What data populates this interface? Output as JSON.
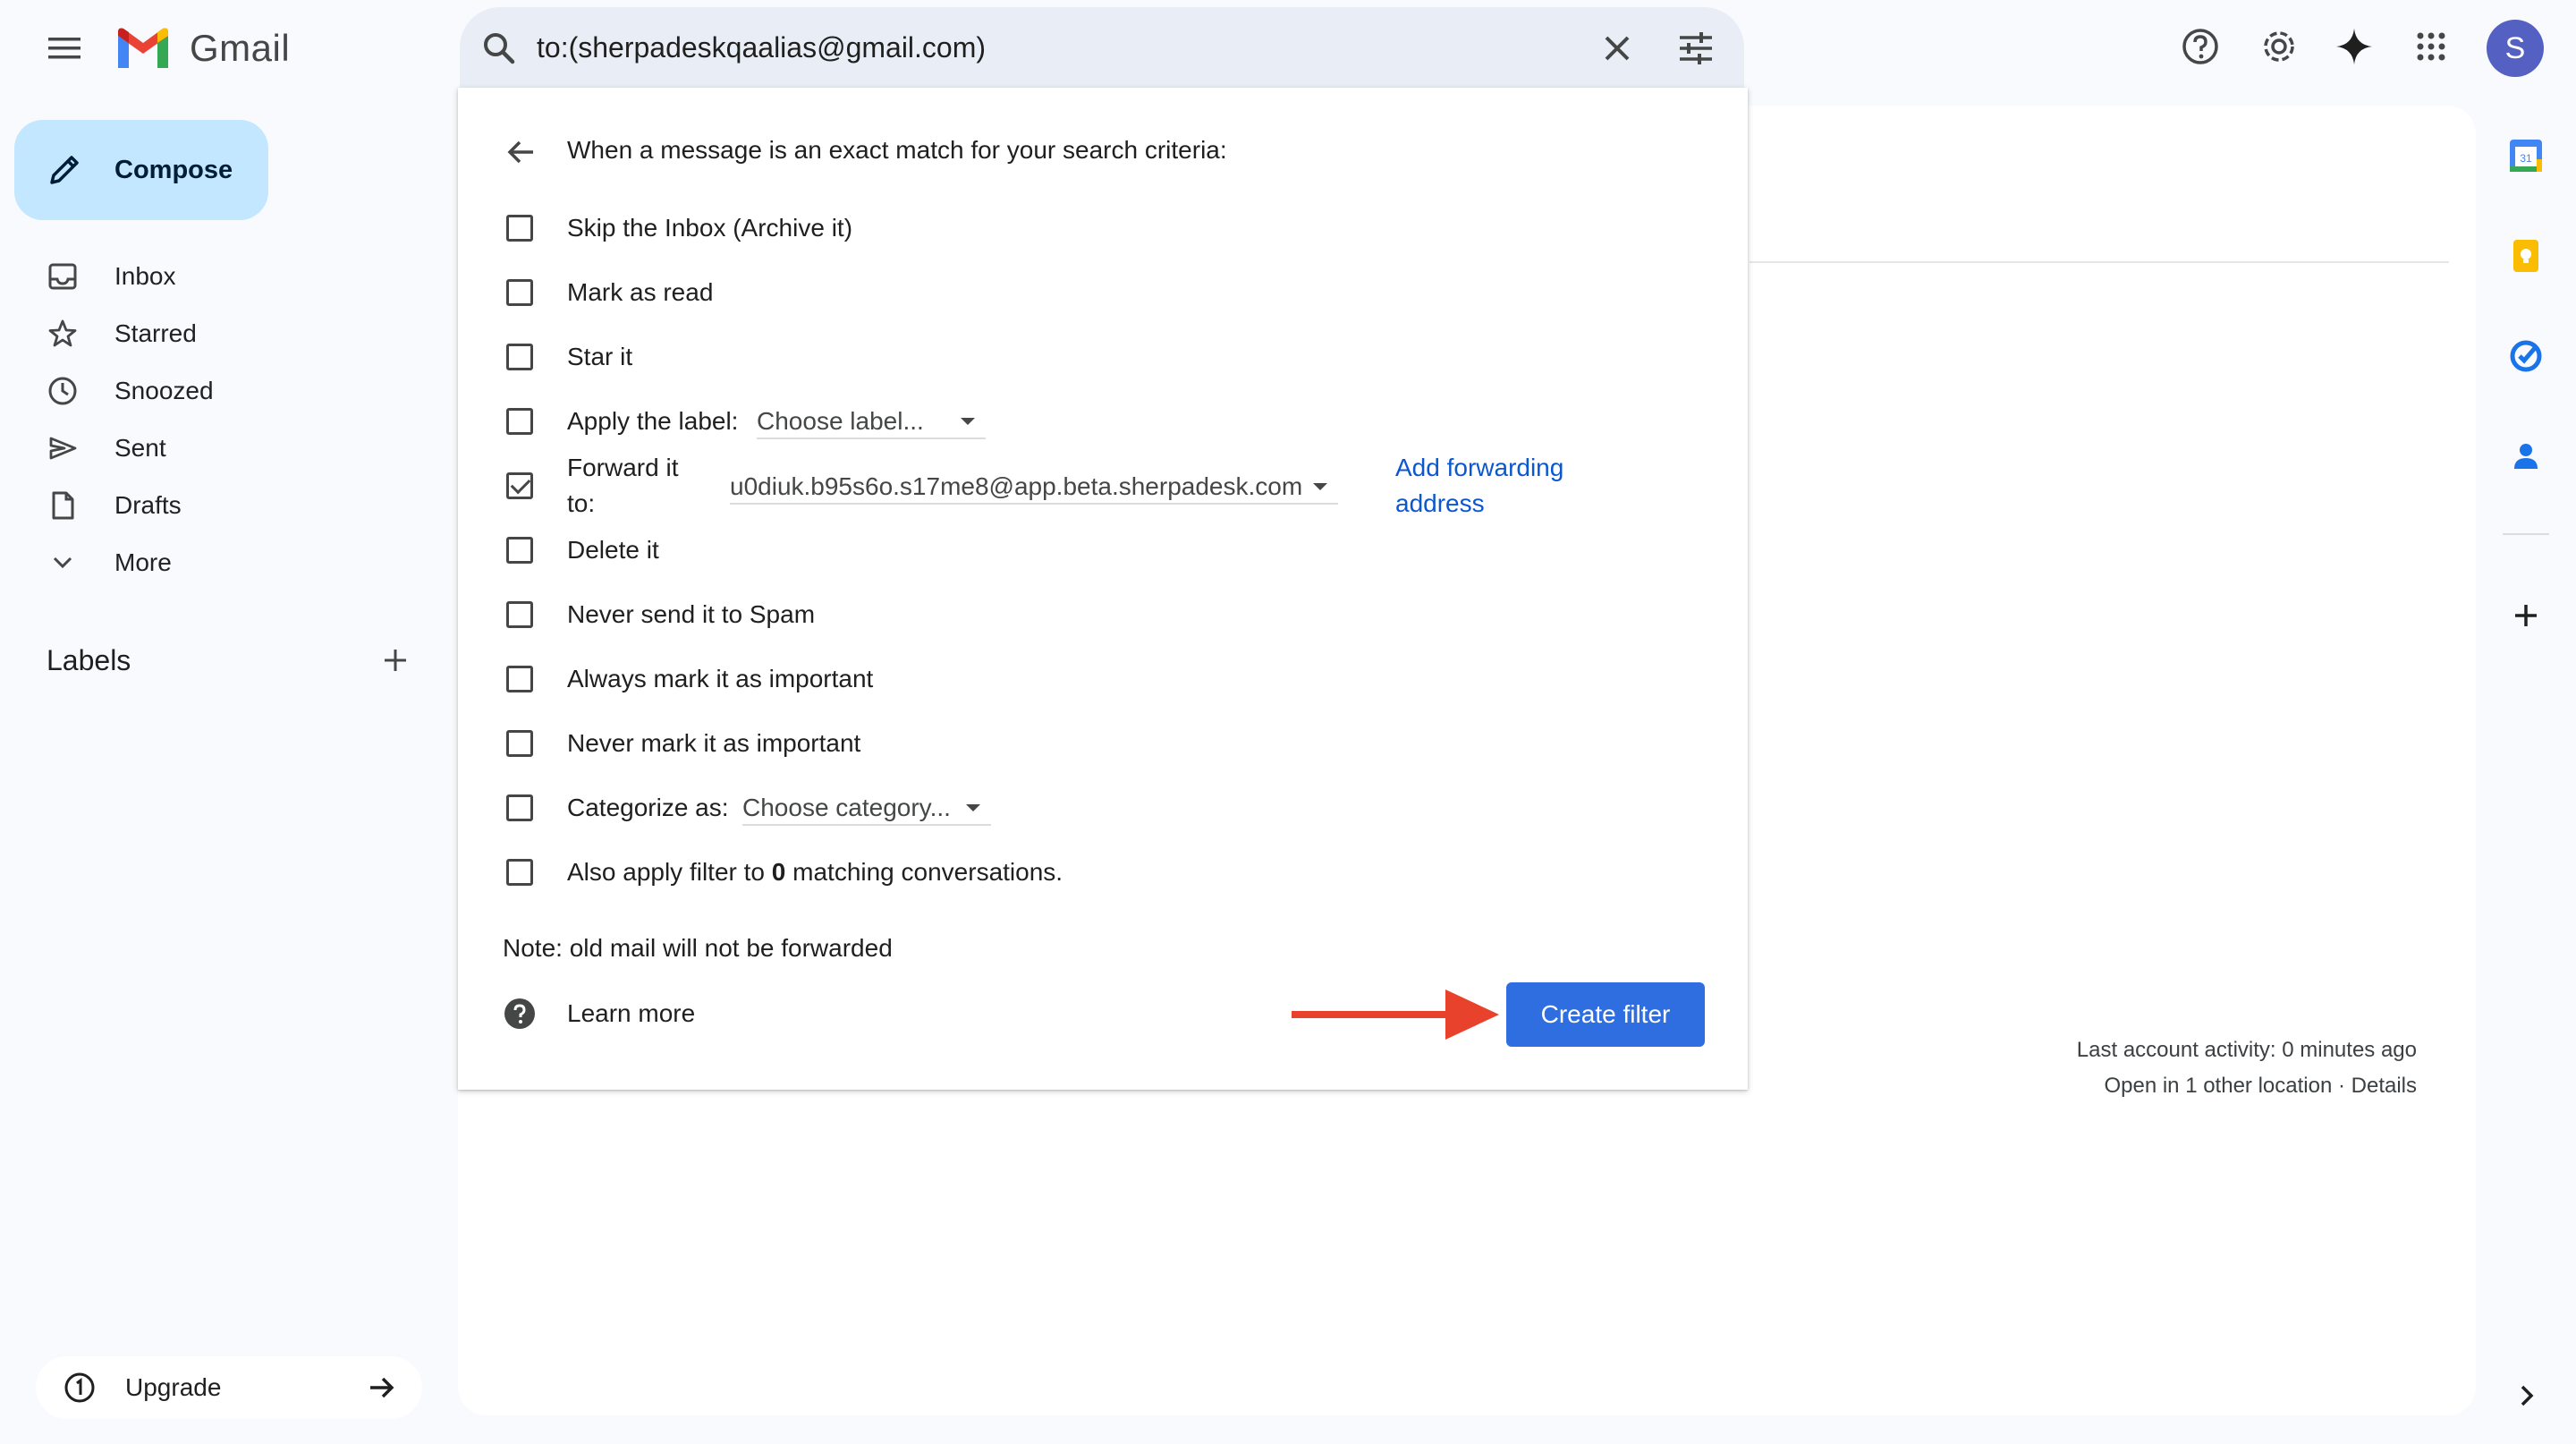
{
  "app": {
    "name": "Gmail"
  },
  "search": {
    "query": "to:(sherpadeskqaalias@gmail.com)"
  },
  "compose": {
    "label": "Compose"
  },
  "nav": {
    "items": [
      {
        "label": "Inbox",
        "icon": "inbox-icon"
      },
      {
        "label": "Starred",
        "icon": "star-icon"
      },
      {
        "label": "Snoozed",
        "icon": "clock-icon"
      },
      {
        "label": "Sent",
        "icon": "send-icon"
      },
      {
        "label": "Drafts",
        "icon": "draft-icon"
      },
      {
        "label": "More",
        "icon": "chevron-down-icon"
      }
    ]
  },
  "labels": {
    "title": "Labels"
  },
  "upgrade": {
    "label": "Upgrade"
  },
  "filter": {
    "heading": "When a message is an exact match for your search criteria:",
    "options": {
      "skip_inbox": {
        "label": "Skip the Inbox (Archive it)",
        "checked": false
      },
      "mark_read": {
        "label": "Mark as read",
        "checked": false
      },
      "star_it": {
        "label": "Star it",
        "checked": false
      },
      "apply_label": {
        "label": "Apply the label:",
        "checked": false,
        "select_value": "Choose label..."
      },
      "forward": {
        "label_line1": "Forward it",
        "label_line2": "to:",
        "checked": true,
        "select_value": "u0diuk.b95s6o.s17me8@app.beta.sherpadesk.com"
      },
      "add_forwarding_line1": "Add forwarding",
      "add_forwarding_line2": "address",
      "delete_it": {
        "label": "Delete it",
        "checked": false
      },
      "never_spam": {
        "label": "Never send it to Spam",
        "checked": false
      },
      "always_important": {
        "label": "Always mark it as important",
        "checked": false
      },
      "never_important": {
        "label": "Never mark it as important",
        "checked": false
      },
      "categorize": {
        "label": "Categorize as:",
        "checked": false,
        "select_value": "Choose category..."
      },
      "also_apply": {
        "label_prefix": "Also apply filter to",
        "count": "0",
        "label_suffix": "matching conversations.",
        "checked": false
      }
    },
    "note": "Note: old mail will not be forwarded",
    "learn_more": "Learn more",
    "create_button": "Create filter"
  },
  "footer": {
    "activity_line1": "Last account activity: 0 minutes ago",
    "activity_line2": "Open in 1 other location · Details"
  },
  "avatar": {
    "initial": "S",
    "color": "#5460c2"
  },
  "colors": {
    "accent": "#2f6ee0",
    "compose_bg": "#c2e7ff",
    "link": "#0b57d0",
    "annotation_arrow": "#e8412c"
  }
}
